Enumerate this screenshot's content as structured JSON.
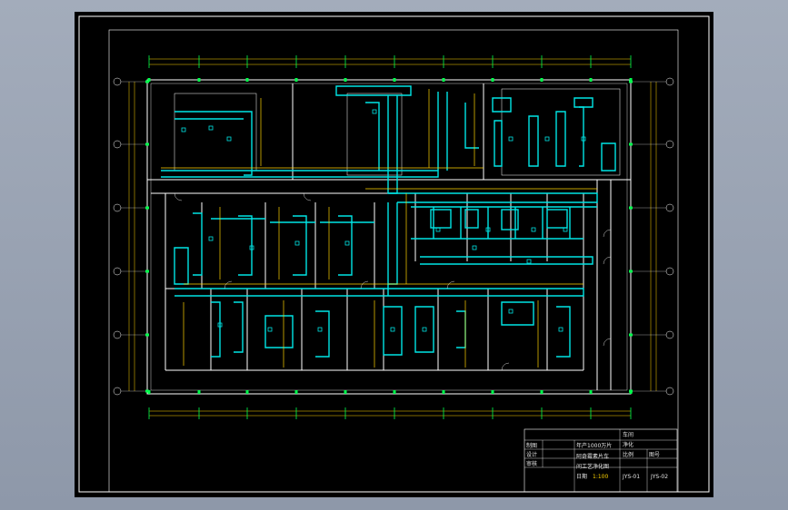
{
  "title_block": {
    "rows_left": [
      "制图",
      "设计",
      "审核"
    ],
    "project_line1": "年产1000万片",
    "project_line2": "阿奇霉素片车",
    "project_line3": "间工艺净化图",
    "sheet_name": "车间",
    "sheet_desc": "净化",
    "scale_label": "比例",
    "scale_value": "1:100",
    "material_label": "材料",
    "material_value": "",
    "date_label": "日期",
    "code_label": "图号",
    "code_a": "JYS-01",
    "code_b": "JYS-02"
  },
  "colors": {
    "sheet_bg": "#000000",
    "frame": "#ffffff",
    "wall": "#ffffff",
    "duct": "#00e5e5",
    "duct_yellow": "#ffd400",
    "grid_marker": "#00ff4c",
    "dimension": "#ffd400"
  },
  "grid_axes": {
    "rows": [
      "⑦",
      "⑥",
      "⑤",
      "④",
      "③",
      "②",
      "①"
    ]
  }
}
